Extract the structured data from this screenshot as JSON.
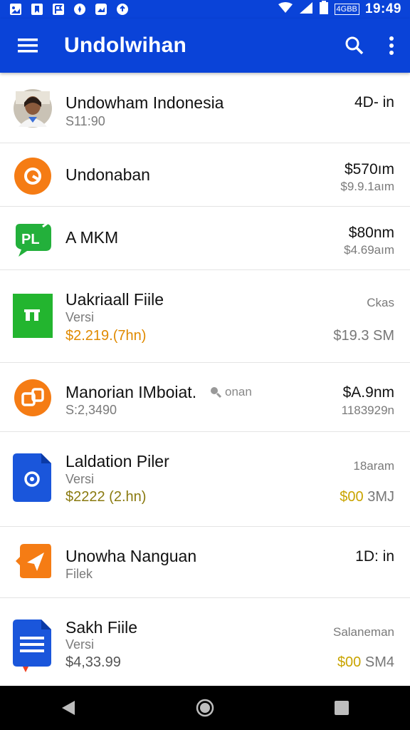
{
  "status_bar": {
    "time": "19:49",
    "carrier": "4GBB",
    "notification_icons": [
      "gallery-icon",
      "bookmark-icon",
      "flag-icon",
      "compass-icon",
      "image-icon",
      "upload-icon"
    ]
  },
  "app_bar": {
    "title": "Undolwihan",
    "color": "#0a43d8"
  },
  "items": [
    {
      "title": "Undowham Indonesia",
      "subtitle": "S11:90",
      "right_top": "4D- in",
      "right_bottom": "",
      "icon": "avatar-photo"
    },
    {
      "title": "Undonaban",
      "subtitle": "",
      "right_top": "$570ım",
      "right_bottom": "$9.9.1aım",
      "icon": "orange-circle-icon"
    },
    {
      "title": "A MKM",
      "subtitle": "",
      "right_top": "$80nm",
      "right_bottom": "$4.69aım",
      "icon": "green-chat-icon"
    },
    {
      "title": "Uakriaall Fiile",
      "subtitle": "Versi",
      "price": "$2.219.(7hn)",
      "right_top": "Ckas",
      "right_bottom": "$19.3 SM",
      "icon": "green-square-icon"
    },
    {
      "title": "Manorian IMboiat.",
      "subtitle": "S:2,3490",
      "tag": "onan",
      "right_top": "$A.9nm",
      "right_bottom": "1183929n",
      "icon": "orange-camera-icon"
    },
    {
      "title": "Laldation Piler",
      "subtitle": "Versi",
      "price": "$2222 (2.hn)",
      "right_top": "18aram",
      "right_bottom_yellow": "$00",
      "right_bottom": " 3MJ",
      "icon": "blue-file-icon"
    },
    {
      "title": "Unowha Nanguan",
      "subtitle": "Filek",
      "right_top": "1D: in",
      "right_bottom": "",
      "icon": "orange-send-icon"
    },
    {
      "title": "Sakh Fiile",
      "subtitle": "Versi",
      "price": "$4,33.99",
      "right_top": "Salaneman",
      "right_bottom_yellow": "$00",
      "right_bottom": " SM4",
      "icon": "blue-doc-icon"
    }
  ],
  "nav_bar": {
    "buttons": [
      "back-icon",
      "home-icon",
      "recents-icon"
    ]
  }
}
